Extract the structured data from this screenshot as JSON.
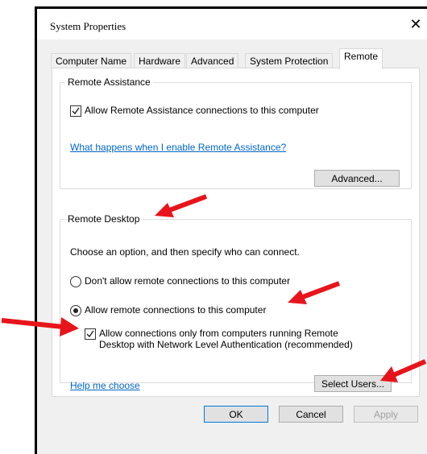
{
  "window": {
    "title": "System Properties",
    "close_glyph": "✕"
  },
  "tabs": [
    {
      "label": "Computer Name",
      "active": false
    },
    {
      "label": "Hardware",
      "active": false
    },
    {
      "label": "Advanced",
      "active": false
    },
    {
      "label": "System Protection",
      "active": false
    },
    {
      "label": "Remote",
      "active": true
    }
  ],
  "remote_assistance": {
    "group_label": "Remote Assistance",
    "allow_checkbox_label": "Allow Remote Assistance connections to this computer",
    "allow_checked": true,
    "help_link": "What happens when I enable Remote Assistance?",
    "advanced_button": "Advanced..."
  },
  "remote_desktop": {
    "group_label": "Remote Desktop",
    "instruction": "Choose an option, and then specify who can connect.",
    "option_dont_allow": "Don't allow remote connections to this computer",
    "option_allow": "Allow remote connections to this computer",
    "selected_option": "allow",
    "nla_label_line1": "Allow connections only from computers running Remote",
    "nla_label_line2": "Desktop with Network Level Authentication (recommended)",
    "nla_checked": true,
    "help_link": "Help me choose",
    "select_users_button": "Select Users..."
  },
  "footer": {
    "ok": "OK",
    "cancel": "Cancel",
    "apply": "Apply"
  },
  "colors": {
    "arrow": "#e8141b",
    "link": "#0066cc",
    "focus": "#0078d7"
  }
}
